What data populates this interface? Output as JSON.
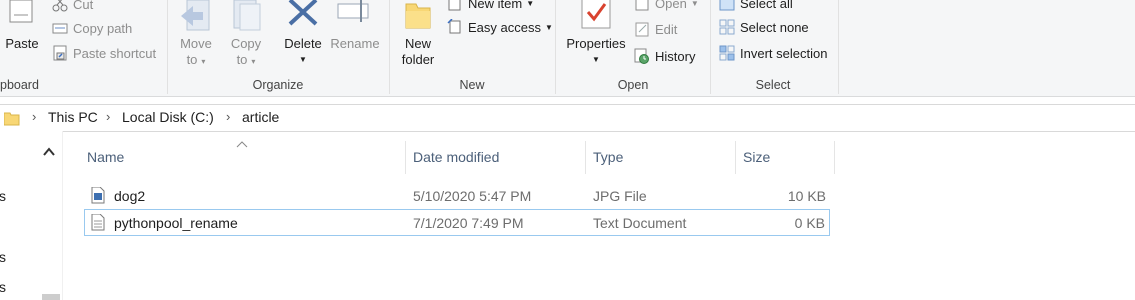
{
  "ribbon": {
    "clipboard": {
      "paste": "Paste",
      "cut": "Cut",
      "copy_path": "Copy path",
      "paste_shortcut": "Paste shortcut",
      "group_label": "pboard"
    },
    "organize": {
      "move_to": "Move",
      "move_to_2": "to",
      "copy_to": "Copy",
      "copy_to_2": "to",
      "delete": "Delete",
      "rename": "Rename",
      "group_label": "Organize"
    },
    "new": {
      "new_folder": "New",
      "new_folder_2": "folder",
      "new_item": "New item",
      "easy_access": "Easy access",
      "group_label": "New"
    },
    "open": {
      "properties": "Properties",
      "open": "Open",
      "edit": "Edit",
      "history": "History",
      "group_label": "Open"
    },
    "select": {
      "select_all": "Select all",
      "select_none": "Select none",
      "invert_selection": "Invert selection",
      "group_label": "Select"
    }
  },
  "address": {
    "crumbs": [
      "This PC",
      "Local Disk (C:)",
      "article"
    ]
  },
  "navpane": {
    "items": [
      "s",
      "s",
      "s"
    ]
  },
  "columns": {
    "name": "Name",
    "date_modified": "Date modified",
    "type": "Type",
    "size": "Size"
  },
  "files": [
    {
      "name": "dog2",
      "date": "5/10/2020 5:47 PM",
      "type": "JPG File",
      "size": "10 KB",
      "icon": "image-file-icon"
    },
    {
      "name": "pythonpool_rename",
      "date": "7/1/2020 7:49 PM",
      "type": "Text Document",
      "size": "0 KB",
      "icon": "text-file-icon"
    }
  ],
  "colors": {
    "selection_border": "#99c9ef",
    "header_text": "#4c607a",
    "folder_yellow": "#f8d775",
    "delete_blue": "#4a6fa5",
    "properties_red": "#d9432f"
  }
}
